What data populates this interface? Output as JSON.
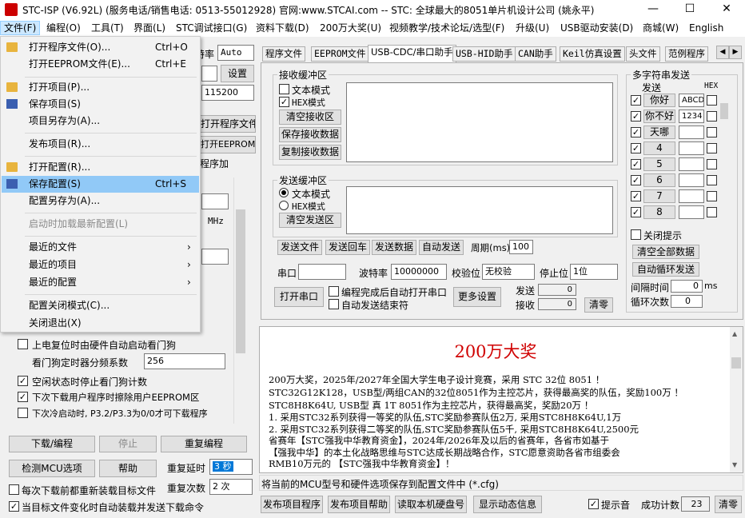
{
  "window": {
    "title": "STC-ISP (V6.92L) (服务电话/销售电话: 0513-55012928) 官网:www.STCAI.com  -- STC: 全球最大的8051单片机设计公司 (姚永平)",
    "minimize": "—",
    "maximize": "☐",
    "close": "✕"
  },
  "menu": [
    {
      "label": "文件(F)"
    },
    {
      "label": "编程(O)"
    },
    {
      "label": "工具(T)"
    },
    {
      "label": "界面(L)"
    },
    {
      "label": "STC调试接口(G)"
    },
    {
      "label": "资料下载(D)"
    },
    {
      "label": "200万大奖(U)"
    },
    {
      "label": "视频教学/技术论坛/选型(F)"
    },
    {
      "label": "升级(U)"
    },
    {
      "label": "USB驱动安装(D)"
    },
    {
      "label": "商城(W)"
    },
    {
      "label": "English"
    }
  ],
  "file_menu": {
    "items": [
      {
        "label": "打开程序文件(O)...",
        "shortcut": "Ctrl+O",
        "icon": "folder"
      },
      {
        "label": "打开EEPROM文件(E)...",
        "shortcut": "Ctrl+E"
      },
      {
        "label": "打开项目(P)...",
        "icon": "folder"
      },
      {
        "label": "保存项目(S)",
        "icon": "disk"
      },
      {
        "label": "项目另存为(A)..."
      },
      {
        "label": "发布项目(R)..."
      },
      {
        "label": "打开配置(R)...",
        "icon": "folder"
      },
      {
        "label": "保存配置(S)",
        "shortcut": "Ctrl+S",
        "icon": "disk"
      },
      {
        "label": "配置另存为(A)..."
      },
      {
        "label": "启动时加载最新配置(L)"
      },
      {
        "label": "最近的文件"
      },
      {
        "label": "最近的项目"
      },
      {
        "label": "最近的配置"
      },
      {
        "label": "配置关闭模式(C)..."
      },
      {
        "label": "关闭退出(X)"
      }
    ],
    "arrow": "›"
  },
  "left": {
    "baud_partial": "波特率",
    "baud_value": "Auto",
    "settings_button": "设置",
    "freq_value": "115200",
    "open_prog_button": "打开程序文件",
    "open_eeprom_button": "打开EEPROM文件",
    "tab_partial": "程序加",
    "mhz": "MHz",
    "options": [
      {
        "label": "上电复位时由硬件自动启动看门狗",
        "checked": false
      },
      {
        "label": "看门狗定时器分频系数",
        "value": "256"
      },
      {
        "label": "空闲状态时停止看门狗计数",
        "checked": true
      },
      {
        "label": "下次下载用户程序时擦除用户EEPROM区",
        "checked": true
      },
      {
        "label": "下次冷启动时, P3.2/P3.3为0/0才可下载程序",
        "checked": false
      }
    ],
    "download_button": "下载/编程",
    "stop_button": "停止",
    "reprogram_button": "重复编程",
    "check_mcu_button": "检测MCU选项",
    "help_button": "帮助",
    "repeat_delay_label": "重复延时",
    "repeat_delay_value": "3 秒",
    "repeat_count_label": "重复次数",
    "repeat_count_value": "2 次",
    "reload_label": "每次下载前都重新装载目标文件",
    "reload_checked": false,
    "auto_send_label": "当目标文件变化时自动装载并发送下载命令",
    "auto_send_checked": true
  },
  "tabs": [
    {
      "label": "程序文件"
    },
    {
      "label": "EEPROM文件"
    },
    {
      "label": "USB-CDC/串口助手"
    },
    {
      "label": "USB-HID助手"
    },
    {
      "label": "CAN助手"
    },
    {
      "label": "Keil仿真设置"
    },
    {
      "label": "头文件"
    },
    {
      "label": "范例程序"
    }
  ],
  "serial": {
    "recv_title": "接收缓冲区",
    "text_mode": "文本模式",
    "hex_mode": "HEX模式",
    "clear_recv": "清空接收区",
    "save_recv": "保存接收数据",
    "copy_recv": "复制接收数据",
    "send_title": "发送缓冲区",
    "clear_send": "清空发送区",
    "send_file": "发送文件",
    "send_enter": "发送回车",
    "send_data": "发送数据",
    "auto_send": "自动发送",
    "period_label": "周期(ms)",
    "period_value": "100",
    "port_label": "串口",
    "baud_label": "波特率",
    "baud_value": "10000000",
    "parity_label": "校验位",
    "parity_value": "无校验",
    "stop_label": "停止位",
    "stop_value": "1位",
    "open_port": "打开串口",
    "auto_open": "编程完成后自动打开串口",
    "auto_end": "自动发送结束符",
    "more_settings": "更多设置",
    "send_label": "发送",
    "send_count": "0",
    "recv_label": "接收",
    "recv_count": "0",
    "clear_button": "清零"
  },
  "multi": {
    "title": "多字符串发送",
    "send_header": "发送",
    "hex_header": "HEX",
    "rows": [
      {
        "label": "你好",
        "value": "ABCD"
      },
      {
        "label": "你不好",
        "value": "1234"
      },
      {
        "label": "天哪",
        "value": ""
      },
      {
        "label": "4",
        "value": ""
      },
      {
        "label": "5",
        "value": ""
      },
      {
        "label": "6",
        "value": ""
      },
      {
        "label": "7",
        "value": ""
      },
      {
        "label": "8",
        "value": ""
      }
    ],
    "close_hint": "关闭提示",
    "clear_all": "清空全部数据",
    "auto_loop": "自动循环发送",
    "interval_label": "间隔时间",
    "interval_value": "0",
    "interval_unit": "ms",
    "loop_label": "循环次数",
    "loop_value": "0"
  },
  "news": {
    "title": "200万大奖",
    "lines": [
      "200万大奖，2025年/2027年全国大学生电子设计竞赛，采用 STC 32位 8051 ！",
      "STC32G12K128，USB型/两组CAN的32位8051作为主控芯片，获得最高奖的队伍，奖励100万 ！",
      "STC8H8K64U, USB型 真 1T 8051作为主控芯片，获得最高奖，奖励20万 ！",
      "1. 采用STC32系列获得一等奖的队伍,STC奖励参赛队伍2万, 采用STC8H8K64U,1万",
      "2. 采用STC32系列获得二等奖的队伍,STC奖励参赛队伍5千, 采用STC8H8K64U,2500元",
      "省赛年【STC强我中华教育资金】，2024年/2026年及以后的省赛年，各省市如基于",
      "【强我中华】的本土化战略思维与STC达成长期战略合作，STC愿意资助各省市组委会",
      "RMB10万元的 【STC强我中华教育资金】！"
    ]
  },
  "status_text": "将当前的MCU型号和硬件选项保存到配置文件中 (*.cfg)",
  "bottom": {
    "publish_prog": "发布项目程序",
    "publish_help": "发布项目帮助",
    "read_disk_id": "读取本机硬盘号",
    "show_anim": "显示动态信息",
    "beep_label": "提示音",
    "beep_checked": true,
    "success_label": "成功计数",
    "success_value": "23",
    "clear": "清零"
  }
}
